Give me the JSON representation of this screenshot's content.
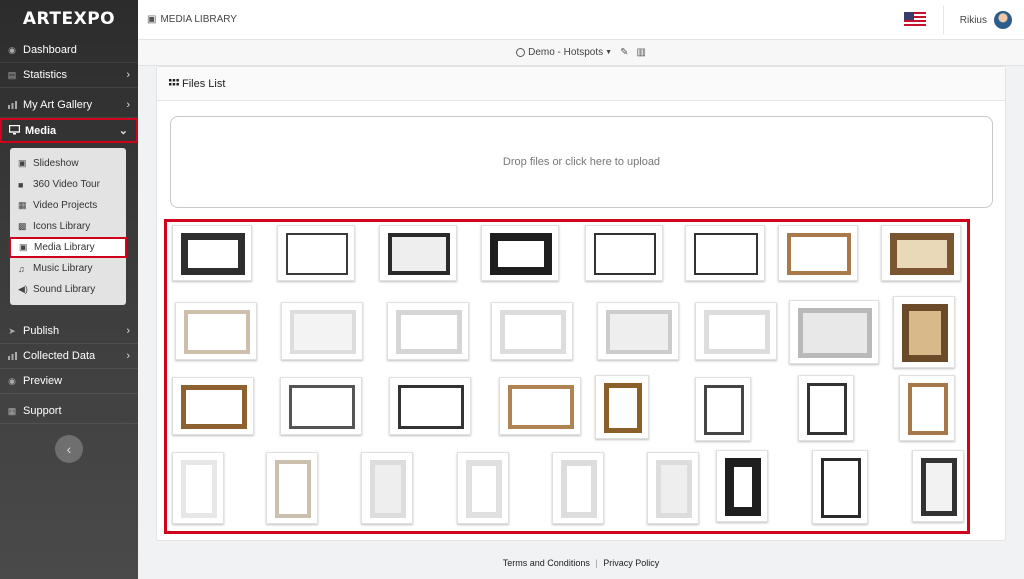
{
  "logo": "ARTEXPO",
  "sidebar": {
    "items": [
      {
        "label": "Dashboard",
        "icon": "dashboard-icon",
        "glyph": "◉",
        "chevron": false
      },
      {
        "label": "Statistics",
        "icon": "chart-icon",
        "glyph": "▤",
        "chevron": true
      },
      {
        "label": "My Art Gallery",
        "icon": "gallery-icon",
        "glyph": "",
        "chevron": true
      },
      {
        "label": "Media",
        "icon": "monitor-icon",
        "glyph": "▭",
        "chevron": true,
        "active": true
      },
      {
        "label": "Publish",
        "icon": "send-icon",
        "glyph": "➤",
        "chevron": true
      },
      {
        "label": "Collected Data",
        "icon": "data-icon",
        "glyph": "",
        "chevron": true
      },
      {
        "label": "Preview",
        "icon": "eye-icon",
        "glyph": "◉",
        "chevron": false
      },
      {
        "label": "Support",
        "icon": "support-icon",
        "glyph": "▦",
        "chevron": false
      }
    ],
    "media_submenu": [
      {
        "label": "Slideshow",
        "icon": "slideshow-icon",
        "glyph": "▣"
      },
      {
        "label": "360 Video Tour",
        "icon": "video-camera-icon",
        "glyph": "■"
      },
      {
        "label": "Video Projects",
        "icon": "film-icon",
        "glyph": "▦"
      },
      {
        "label": "Icons Library",
        "icon": "icons-icon",
        "glyph": "▩"
      },
      {
        "label": "Media Library",
        "icon": "media-library-icon",
        "glyph": "▣",
        "active": true
      },
      {
        "label": "Music Library",
        "icon": "music-icon",
        "glyph": "♫"
      },
      {
        "label": "Sound Library",
        "icon": "speaker-icon",
        "glyph": "◀)"
      }
    ]
  },
  "header": {
    "page_title": "MEDIA LIBRARY",
    "user_name": "Rikius"
  },
  "subheader": {
    "project": "Demo - Hotspots"
  },
  "files_list": {
    "title": "Files List",
    "dropzone_text": "Drop files or click here to upload"
  },
  "footer": {
    "terms": "Terms and Conditions",
    "separator": "|",
    "privacy": "Privacy Policy"
  },
  "colors": {
    "highlight": "#d0021b",
    "sidebar_bg": "#333333"
  }
}
